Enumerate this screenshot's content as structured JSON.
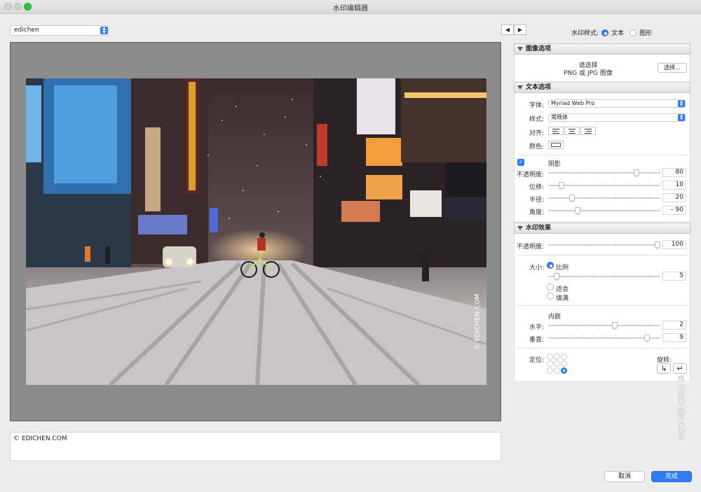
{
  "window": {
    "title": "水印编辑器"
  },
  "preset": {
    "value": "edichen"
  },
  "canvas": {
    "watermark_text": "© EDICHEN.COM"
  },
  "text_input": {
    "value": "© EDICHEN.COM"
  },
  "nav": {
    "prev": "◀",
    "next": "▶"
  },
  "watermark_style": {
    "label": "水印样式:",
    "options": [
      "文本",
      "图形"
    ],
    "selected": "文本"
  },
  "image_options": {
    "title": "图像选项",
    "prompt_line1": "请选择",
    "prompt_line2": "PNG 或 JPG 图像",
    "choose_button": "选择..."
  },
  "text_options": {
    "title": "文本选项",
    "font_label": "字体:",
    "font_value": "Myriad Web Pro",
    "style_label": "样式:",
    "style_value": "常规体",
    "align_label": "对齐:",
    "align_options": [
      "left",
      "center",
      "right"
    ],
    "color_label": "颜色:",
    "color_value": "#ffffff",
    "shadow": {
      "label": "阴影",
      "enabled": true,
      "opacity_label": "不透明度:",
      "opacity": "80",
      "opacity_fraction": 0.8,
      "offset_label": "位移:",
      "offset": "10",
      "offset_fraction": 0.1,
      "radius_label": "半径:",
      "radius": "20",
      "radius_fraction": 0.2,
      "angle_label": "角度:",
      "angle": "– 90",
      "angle_fraction": 0.25
    }
  },
  "watermark_effects": {
    "title": "水印效果",
    "opacity_label": "不透明度:",
    "opacity": "100",
    "opacity_fraction": 1.0,
    "size_label": "大小:",
    "size_options": [
      "比例",
      "适合",
      "填满"
    ],
    "size_selected": "比例",
    "scale": "5",
    "scale_fraction": 0.05,
    "inset_label": "内嵌",
    "horizontal_label": "水平:",
    "horizontal": "2",
    "horizontal_fraction": 0.6,
    "vertical_label": "垂直:",
    "vertical": "9",
    "vertical_fraction": 0.9,
    "anchor_label": "定位:",
    "anchor_selected": "bottom-right",
    "rotate_label": "旋转:"
  },
  "footer": {
    "cancel": "取消",
    "done": "完成"
  },
  "side_watermark": "© EDICHEN.COM",
  "colors": {
    "accent": "#2f7cf6",
    "canvas_bg": "#8c8c8c",
    "window_bg": "#ececec"
  }
}
